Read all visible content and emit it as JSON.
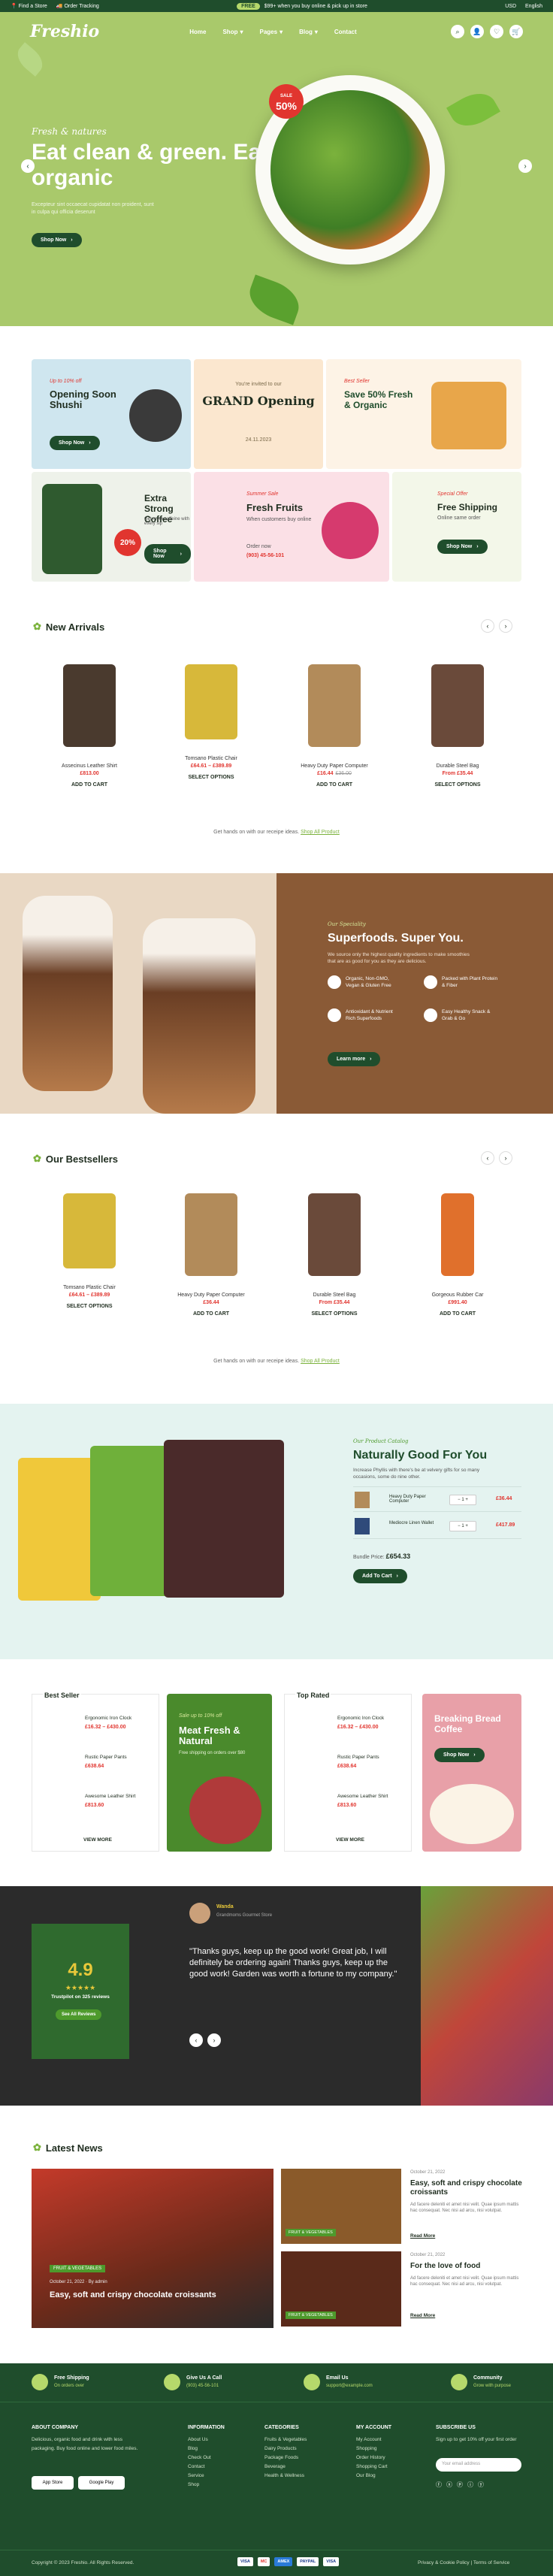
{
  "topbar": {
    "find_store": "Find a Store",
    "order_tracking": "Order Tracking",
    "promo_badge": "FREE",
    "promo_text": "$99+ when you buy online & pick up in store",
    "currency": "USD",
    "language": "English"
  },
  "nav": {
    "logo": "Freshio",
    "items": [
      "Home",
      "Shop",
      "Pages",
      "Blog",
      "Contact"
    ],
    "cart_count": "0"
  },
  "hero": {
    "tag": "Fresh & natures",
    "title": "Eat clean & green. Eat organic",
    "subtitle": "Excepteur sint occaecat cupidatat non proident, sunt in culpa qui officia deserunt",
    "button": "Shop Now",
    "badge_pct": "50%",
    "badge_label": "SALE"
  },
  "promos": [
    {
      "tag": "Up to 10% off",
      "title": "Opening Soon Shushi",
      "button": "Shop Now"
    },
    {
      "tag": "You're invited to our",
      "title": "GRAND Opening",
      "date": "24.11.2023"
    },
    {
      "tag": "Best Seller",
      "title": "Save 50% Fresh & Organic"
    },
    {
      "tag": "",
      "title": "Extra Strong Coffee",
      "sub": "Get more caffeine with every sip",
      "button": "Shop Now",
      "badge": "20%"
    },
    {
      "tag": "Summer Sale",
      "title": "Fresh Fruits",
      "sub": "When customers buy online",
      "order": "Order now",
      "phone": "(903) 45-56-101"
    },
    {
      "tag": "Special Offer",
      "title": "Free Shipping",
      "sub": "Online same order",
      "button": "Shop Now"
    }
  ],
  "new_arrivals": {
    "title": "New Arrivals",
    "products": [
      {
        "name": "Assecinus Leather Shirt",
        "price": "£813.00",
        "old": "",
        "action": "ADD TO CART"
      },
      {
        "name": "Tomsano Plastic Chair",
        "price": "£64.61 – £389.89",
        "old": "",
        "action": "SELECT OPTIONS"
      },
      {
        "name": "Heavy Duty Paper Computer",
        "price": "£16.44",
        "old": "£36.00",
        "action": "ADD TO CART"
      },
      {
        "name": "Durable Steel Bag",
        "price": "From £35.44",
        "old": "",
        "action": "SELECT OPTIONS"
      }
    ],
    "note": "Get hands on with our receipe ideas.",
    "note_link": "Shop All Product"
  },
  "superfoods": {
    "tag": "Our Speciality",
    "title": "Superfoods. Super You.",
    "desc": "We source only the highest quality ingredients to make smoothies that are as good for you as they are delicious.",
    "features": [
      "Organic, Non-GMO, Vegan & Gluten Free",
      "Packed with Plant Protein & Fiber",
      "Antioxidant & Nutrient Rich Superfoods",
      "Easy Healthy Snack & Grab & Go"
    ],
    "button": "Learn more"
  },
  "bestsellers": {
    "title": "Our Bestsellers",
    "products": [
      {
        "name": "Tomsano Plastic Chair",
        "price": "£64.61 – £389.89",
        "action": "SELECT OPTIONS"
      },
      {
        "name": "Heavy Duty Paper Computer",
        "price": "£36.44",
        "action": "ADD TO CART"
      },
      {
        "name": "Durable Steel Bag",
        "price": "From £35.44",
        "action": "SELECT OPTIONS"
      },
      {
        "name": "Gorgeous Rubber Car",
        "price": "£991.40",
        "action": "ADD TO CART"
      }
    ],
    "note": "Get hands on with our receipe ideas.",
    "note_link": "Shop All Product"
  },
  "bundle": {
    "tag": "Our Product Catalog",
    "title": "Naturally Good For You",
    "desc": "Increase Phyllis with there's be at velvery gifts for so many occasions, some do nine other.",
    "items": [
      {
        "name": "Heavy Duty Paper Computer",
        "price": "£36.44"
      },
      {
        "name": "Mediocre Linen Wallet",
        "price": "£417.89"
      }
    ],
    "total_label": "Bundle Price:",
    "total": "£654.33",
    "button": "Add To Cart"
  },
  "lists": {
    "best_seller": "Best Seller",
    "top_rated": "Top Rated",
    "items_left": [
      {
        "name": "Ergonomic Iron Clock",
        "price": "£16.32 – £430.00"
      },
      {
        "name": "Rustic Paper Pants",
        "price": "£638.64"
      },
      {
        "name": "Awesome Leather Shirt",
        "price": "£813.60"
      }
    ],
    "items_right": [
      {
        "name": "Ergonomic Iron Clock",
        "price": "£16.32 – £430.00"
      },
      {
        "name": "Rustic Paper Pants",
        "price": "£638.64"
      },
      {
        "name": "Awesome Leather Shirt",
        "price": "£813.60"
      }
    ],
    "view_more": "VIEW MORE",
    "meat": {
      "tag": "Sale up to 10% off",
      "title": "Meat Fresh & Natural",
      "sub": "Free shipping on orders over $80",
      "button": "Shop Now"
    },
    "coffee": {
      "title": "Breaking Bread Coffee",
      "button": "Shop Now"
    }
  },
  "testimonial": {
    "rating": "4.9",
    "stars": "★★★★★",
    "trust": "Trustpilot on 325 reviews",
    "review_btn": "See All Reviews",
    "author": "Wanda",
    "role": "Grandmoms Gourmet Store",
    "quote": "\"Thanks guys, keep up the good work! Great job, I will definitely be ordering again! Thanks guys, keep up the good work! Garden was worth a fortune to my company.\""
  },
  "news": {
    "title": "Latest News",
    "main": {
      "tag": "FRUIT & VEGETABLES",
      "date": "October 21, 2022",
      "author": "By admin",
      "title": "Easy, soft and crispy chocolate croissants"
    },
    "side": [
      {
        "tag": "FRUIT & VEGETABLES",
        "date": "October 21, 2022",
        "title": "Easy, soft and crispy chocolate croissants",
        "excerpt": "Ad facere deleniti et amet nisi velit. Quae ipsum mattis hac consequat. Nec nisi ad arcu, nisi volutpat.",
        "more": "Read More"
      },
      {
        "tag": "FRUIT & VEGETABLES",
        "date": "October 21, 2022",
        "title": "For the love of food",
        "excerpt": "Ad facere deleniti et amet nisi velit. Quae ipsum mattis hac consequat. Nec nisi ad arcu, nisi volutpat.",
        "more": "Read More"
      }
    ]
  },
  "services": [
    {
      "title": "Free Shipping",
      "sub": "On orders over"
    },
    {
      "title": "Give Us A Call",
      "sub": "(903) 45-56-101"
    },
    {
      "title": "Email Us",
      "sub": "support@example.com"
    },
    {
      "title": "Community",
      "sub": "Grow with purpose"
    }
  ],
  "footer": {
    "about_title": "ABOUT COMPANY",
    "about_text": "Delicious, organic food and drink with less packaging. Buy food online and lower food miles.",
    "app_store": "App Store",
    "google_play": "Google Play",
    "cols": [
      {
        "title": "INFORMATION",
        "items": [
          "About Us",
          "Blog",
          "Check Out",
          "Contact",
          "Service",
          "Shop"
        ]
      },
      {
        "title": "CATEGORIES",
        "items": [
          "Fruits & Vegetables",
          "Dairy Products",
          "Package Foods",
          "Beverage",
          "Health & Wellness"
        ]
      },
      {
        "title": "MY ACCOUNT",
        "items": [
          "My Account",
          "Shopping",
          "Order History",
          "Shopping Cart",
          "Our Blog"
        ]
      }
    ],
    "subscribe_title": "SUBSCRIBE US",
    "subscribe_text": "Sign up to get 10% off your first order",
    "email_placeholder": "Your email address",
    "copyright": "Copyright © 2023 Freshio. All Rights Reserved.",
    "policy": "Privacy & Cookie Policy",
    "terms": "Terms of Service",
    "payments": [
      "VISA",
      "MC",
      "AMEX",
      "PAYPAL",
      "VISA"
    ]
  }
}
